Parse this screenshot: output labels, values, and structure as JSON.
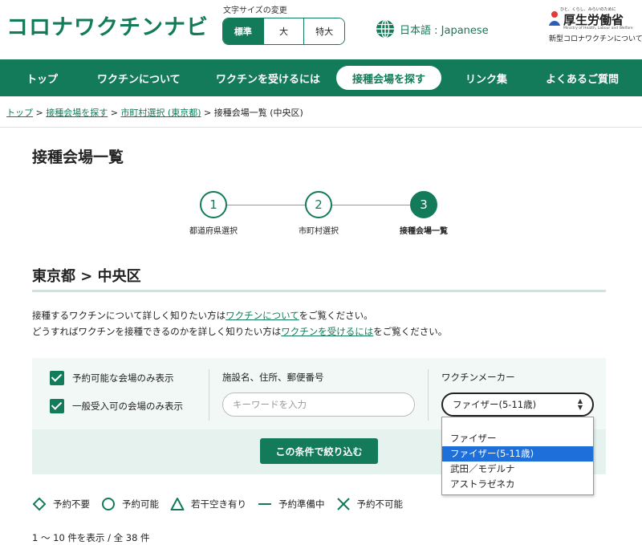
{
  "header": {
    "logo": "コロナワクチンナビ",
    "font_size_label": "文字サイズの変更",
    "font_sizes": [
      "標準",
      "大",
      "特大"
    ],
    "language": "日本語 : Japanese",
    "mhlw_tagline": "ひと、くらし、みらいのために",
    "mhlw_name": "厚生労働省",
    "mhlw_en": "Ministry of Health, Labour and Welfare",
    "mhlw_sub": "新型コロナワクチンについて"
  },
  "nav": [
    "トップ",
    "ワクチンについて",
    "ワクチンを受けるには",
    "接種会場を探す",
    "リンク集",
    "よくあるご質問"
  ],
  "breadcrumb": {
    "items": [
      "トップ",
      "接種会場を探す",
      "市町村選択 (東京都)"
    ],
    "current": "接種会場一覧 (中央区)",
    "sep": " > "
  },
  "page_title": "接種会場一覧",
  "stepper": [
    {
      "num": "1",
      "label": "都道府県選択"
    },
    {
      "num": "2",
      "label": "市町村選択"
    },
    {
      "num": "3",
      "label": "接種会場一覧"
    }
  ],
  "region": "東京都 > 中央区",
  "description": {
    "l1_pre": "接種するワクチンについて詳しく知りたい方は",
    "l1_link": "ワクチンについて",
    "l1_post": "をご覧ください。",
    "l2_pre": "どうすればワクチンを接種できるのかを詳しく知りたい方は",
    "l2_link": "ワクチンを受けるには",
    "l2_post": "をご覧ください。"
  },
  "filter": {
    "checkbox1": "予約可能な会場のみ表示",
    "checkbox2": "一般受入可の会場のみ表示",
    "keyword_label": "施設名、住所、郵便番号",
    "keyword_placeholder": "キーワードを入力",
    "vaccine_label": "ワクチンメーカー",
    "vaccine_selected": "ファイザー(5-11歳)",
    "submit": "この条件で絞り込む"
  },
  "dropdown_options": [
    "ファイザー",
    "ファイザー(5-11歳)",
    "武田／モデルナ",
    "アストラゼネカ"
  ],
  "legend": [
    "予約不要",
    "予約可能",
    "若干空き有り",
    "予約準備中",
    "予約不可能"
  ],
  "result_count": "1 〜 10 件を表示 / 全 38 件"
}
